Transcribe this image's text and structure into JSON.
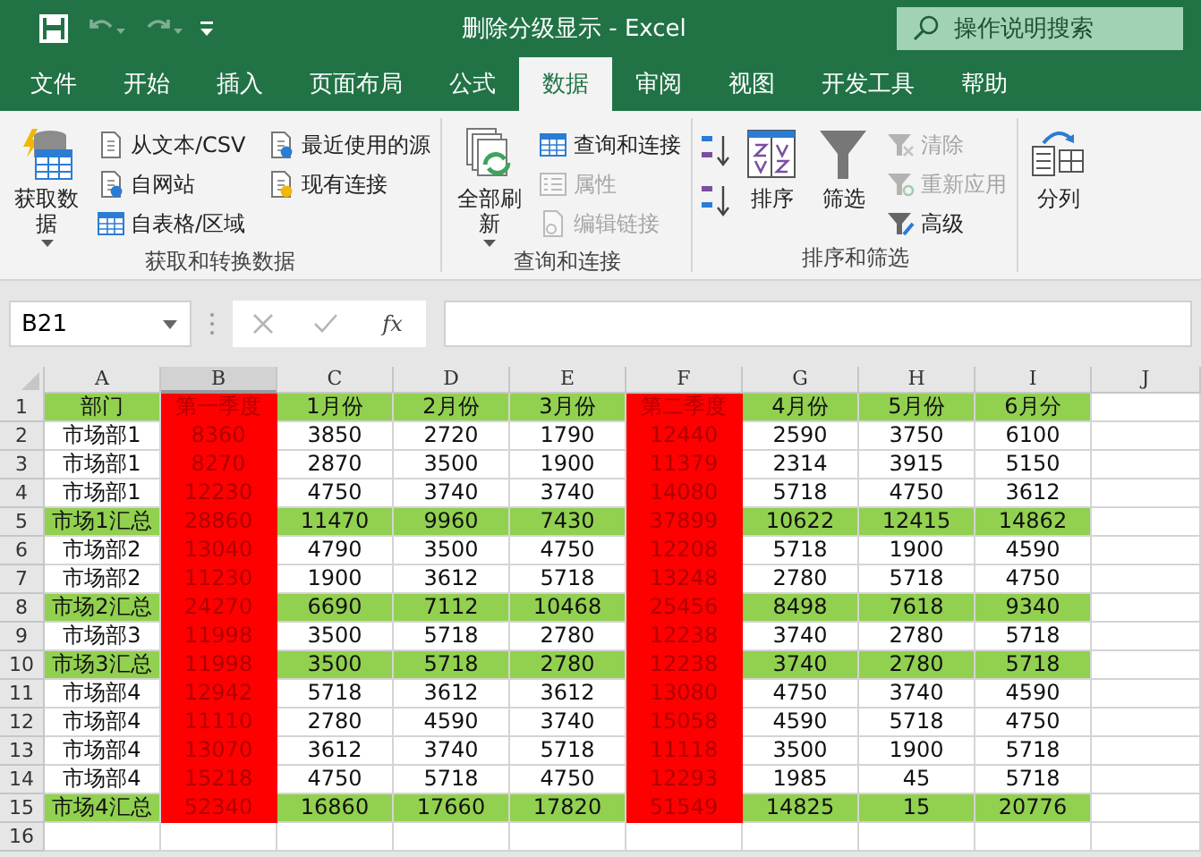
{
  "window": {
    "title": "删除分级显示  -  Excel"
  },
  "search": {
    "placeholder": "操作说明搜索"
  },
  "tabs": [
    {
      "label": "文件",
      "selected": false
    },
    {
      "label": "开始",
      "selected": false
    },
    {
      "label": "插入",
      "selected": false
    },
    {
      "label": "页面布局",
      "selected": false
    },
    {
      "label": "公式",
      "selected": false
    },
    {
      "label": "数据",
      "selected": true
    },
    {
      "label": "审阅",
      "selected": false
    },
    {
      "label": "视图",
      "selected": false
    },
    {
      "label": "开发工具",
      "selected": false
    },
    {
      "label": "帮助",
      "selected": false
    }
  ],
  "ribbon": {
    "groups": [
      {
        "label": "获取和转换数据",
        "items": [
          {
            "kind": "large",
            "label": "获取数据",
            "dropdown": true
          },
          {
            "kind": "small",
            "label": "从文本/CSV",
            "disabled": false
          },
          {
            "kind": "small",
            "label": "自网站",
            "disabled": false
          },
          {
            "kind": "small",
            "label": "自表格/区域",
            "disabled": false
          },
          {
            "kind": "small",
            "label": "最近使用的源",
            "disabled": false
          },
          {
            "kind": "small",
            "label": "现有连接",
            "disabled": false
          }
        ]
      },
      {
        "label": "查询和连接",
        "items": [
          {
            "kind": "large",
            "label": "全部刷新",
            "dropdown": true
          },
          {
            "kind": "small",
            "label": "查询和连接",
            "disabled": false
          },
          {
            "kind": "small",
            "label": "属性",
            "disabled": true
          },
          {
            "kind": "small",
            "label": "编辑链接",
            "disabled": true
          }
        ]
      },
      {
        "label": "排序和筛选",
        "items": [
          {
            "kind": "sort-pair"
          },
          {
            "kind": "large",
            "label": "排序",
            "dropdown": false
          },
          {
            "kind": "large",
            "label": "筛选",
            "dropdown": false
          },
          {
            "kind": "small",
            "label": "清除",
            "disabled": true
          },
          {
            "kind": "small",
            "label": "重新应用",
            "disabled": true
          },
          {
            "kind": "small",
            "label": "高级",
            "disabled": false
          }
        ]
      },
      {
        "items": [
          {
            "kind": "large",
            "label": "分列",
            "dropdown": false
          }
        ]
      }
    ]
  },
  "formula_bar": {
    "name_box": "B21",
    "function_label": "fx"
  },
  "sheet": {
    "columns": [
      {
        "label": "A",
        "selected": false,
        "kind": "plain"
      },
      {
        "label": "B",
        "selected": true,
        "kind": "red"
      },
      {
        "label": "C",
        "selected": false,
        "kind": "plain"
      },
      {
        "label": "D",
        "selected": false,
        "kind": "plain"
      },
      {
        "label": "E",
        "selected": false,
        "kind": "plain"
      },
      {
        "label": "F",
        "selected": false,
        "kind": "red"
      },
      {
        "label": "G",
        "selected": false,
        "kind": "plain"
      },
      {
        "label": "H",
        "selected": false,
        "kind": "plain"
      },
      {
        "label": "I",
        "selected": false,
        "kind": "plain"
      },
      {
        "label": "J",
        "selected": false,
        "kind": "plain"
      }
    ],
    "rows": [
      {
        "number": "1",
        "kind": "green",
        "cells": [
          "部门",
          "第一季度",
          "1月份",
          "2月份",
          "3月份",
          "第二季度",
          "4月份",
          "5月份",
          "6月分"
        ]
      },
      {
        "number": "2",
        "kind": "plain",
        "cells": [
          "市场部1",
          "8360",
          "3850",
          "2720",
          "1790",
          "12440",
          "2590",
          "3750",
          "6100"
        ]
      },
      {
        "number": "3",
        "kind": "plain",
        "cells": [
          "市场部1",
          "8270",
          "2870",
          "3500",
          "1900",
          "11379",
          "2314",
          "3915",
          "5150"
        ]
      },
      {
        "number": "4",
        "kind": "plain",
        "cells": [
          "市场部1",
          "12230",
          "4750",
          "3740",
          "3740",
          "14080",
          "5718",
          "4750",
          "3612"
        ]
      },
      {
        "number": "5",
        "kind": "green",
        "cells": [
          "市场1汇总",
          "28860",
          "11470",
          "9960",
          "7430",
          "37899",
          "10622",
          "12415",
          "14862"
        ]
      },
      {
        "number": "6",
        "kind": "plain",
        "cells": [
          "市场部2",
          "13040",
          "4790",
          "3500",
          "4750",
          "12208",
          "5718",
          "1900",
          "4590"
        ]
      },
      {
        "number": "7",
        "kind": "plain",
        "cells": [
          "市场部2",
          "11230",
          "1900",
          "3612",
          "5718",
          "13248",
          "2780",
          "5718",
          "4750"
        ]
      },
      {
        "number": "8",
        "kind": "green",
        "cells": [
          "市场2汇总",
          "24270",
          "6690",
          "7112",
          "10468",
          "25456",
          "8498",
          "7618",
          "9340"
        ]
      },
      {
        "number": "9",
        "kind": "plain",
        "cells": [
          "市场部3",
          "11998",
          "3500",
          "5718",
          "2780",
          "12238",
          "3740",
          "2780",
          "5718"
        ]
      },
      {
        "number": "10",
        "kind": "green",
        "cells": [
          "市场3汇总",
          "11998",
          "3500",
          "5718",
          "2780",
          "12238",
          "3740",
          "2780",
          "5718"
        ]
      },
      {
        "number": "11",
        "kind": "plain",
        "cells": [
          "市场部4",
          "12942",
          "5718",
          "3612",
          "3612",
          "13080",
          "4750",
          "3740",
          "4590"
        ]
      },
      {
        "number": "12",
        "kind": "plain",
        "cells": [
          "市场部4",
          "11110",
          "2780",
          "4590",
          "3740",
          "15058",
          "4590",
          "5718",
          "4750"
        ]
      },
      {
        "number": "13",
        "kind": "plain",
        "cells": [
          "市场部4",
          "13070",
          "3612",
          "3740",
          "5718",
          "11118",
          "3500",
          "1900",
          "5718"
        ]
      },
      {
        "number": "14",
        "kind": "plain",
        "cells": [
          "市场部4",
          "15218",
          "4750",
          "5718",
          "4750",
          "12293",
          "1985",
          "45",
          "5718"
        ]
      },
      {
        "number": "15",
        "kind": "green",
        "cells": [
          "市场4汇总",
          "52340",
          "16860",
          "17660",
          "17820",
          "51549",
          "14825",
          "15",
          "20776"
        ]
      },
      {
        "number": "16",
        "kind": "plain"
      }
    ]
  }
}
